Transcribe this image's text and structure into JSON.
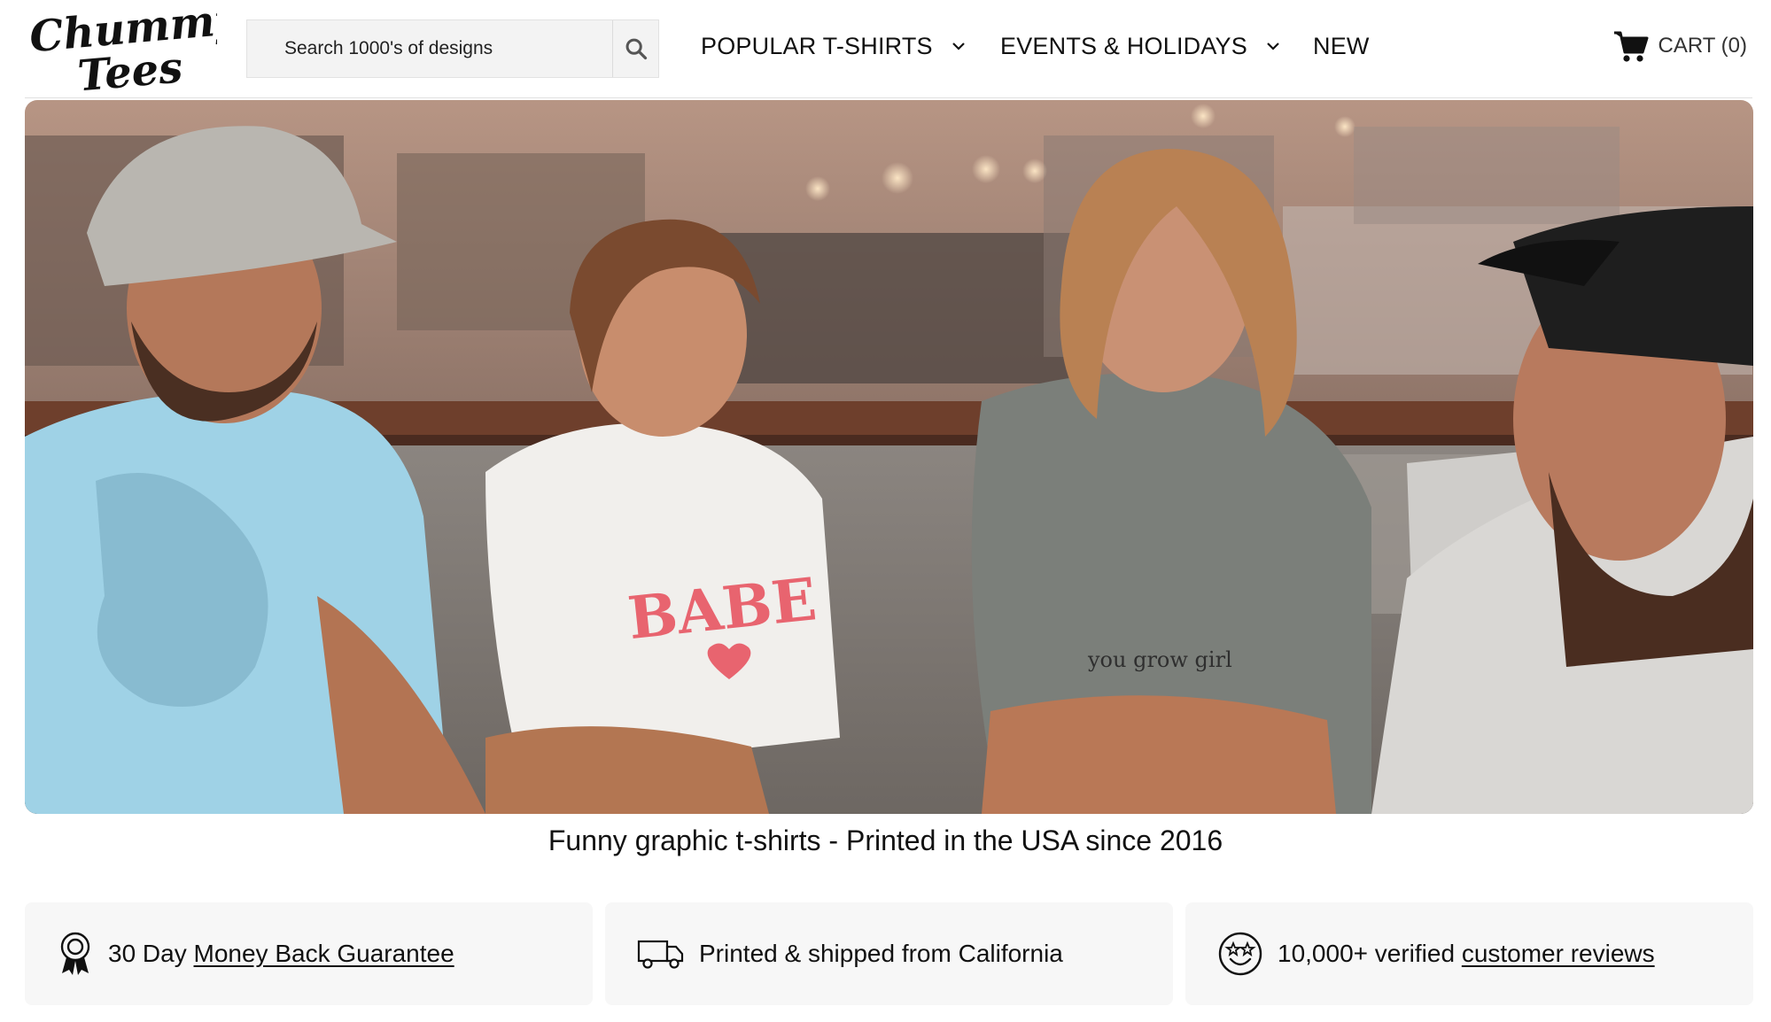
{
  "brand": {
    "logo_line1": "Chummy",
    "logo_line2": "Tees"
  },
  "search": {
    "placeholder": "Search 1000's of designs",
    "value": "",
    "icon": "search-icon"
  },
  "nav": [
    {
      "label": "POPULAR T-SHIRTS",
      "has_dropdown": true
    },
    {
      "label": "EVENTS & HOLIDAYS",
      "has_dropdown": true
    },
    {
      "label": "NEW",
      "has_dropdown": false
    }
  ],
  "cart": {
    "label": "CART (0)",
    "icon": "cart-icon"
  },
  "hero": {
    "shirt_print_1": "BABE",
    "shirt_print_2": "you grow girl"
  },
  "tagline": "Funny graphic t-shirts - Printed in the USA since 2016",
  "features": [
    {
      "icon": "award-ribbon-icon",
      "text": "30 Day ",
      "link": "Money Back Guarantee"
    },
    {
      "icon": "delivery-truck-icon",
      "text": "Printed & shipped from California",
      "link": ""
    },
    {
      "icon": "star-eyes-smiley-icon",
      "text": "10,000+ verified ",
      "link": "customer reviews"
    }
  ],
  "colors": {
    "text": "#111111",
    "search_bg": "#f3f3f3",
    "card_bg": "#f7f7f7",
    "tee_blue": "#9fd2e6",
    "tee_grey": "#7b7f7a",
    "babe_pink": "#e8646f"
  }
}
